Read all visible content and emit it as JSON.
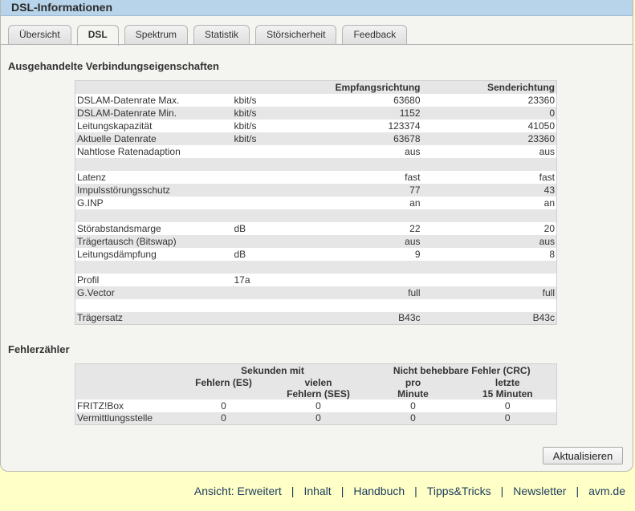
{
  "window": {
    "title": "DSL-Informationen"
  },
  "tabs": [
    "Übersicht",
    "DSL",
    "Spektrum",
    "Statistik",
    "Störsicherheit",
    "Feedback"
  ],
  "section1": {
    "title": "Ausgehandelte Verbindungseigenschaften",
    "headers": {
      "empfang": "Empfangsrichtung",
      "sende": "Senderichtung"
    },
    "rows": [
      {
        "label": "DSLAM-Datenrate Max.",
        "unit": "kbit/s",
        "rx": "63680",
        "tx": "23360"
      },
      {
        "label": "DSLAM-Datenrate Min.",
        "unit": "kbit/s",
        "rx": "1152",
        "tx": "0"
      },
      {
        "label": "Leitungskapazität",
        "unit": "kbit/s",
        "rx": "123374",
        "tx": "41050"
      },
      {
        "label": "Aktuelle Datenrate",
        "unit": "kbit/s",
        "rx": "63678",
        "tx": "23360"
      },
      {
        "label": "Nahtlose Ratenadaption",
        "unit": "",
        "rx": "aus",
        "tx": "aus"
      },
      {
        "label": "",
        "unit": "",
        "rx": "",
        "tx": ""
      },
      {
        "label": "Latenz",
        "unit": "",
        "rx": "fast",
        "tx": "fast"
      },
      {
        "label": "Impulsstörungsschutz",
        "unit": "",
        "rx": "77",
        "tx": "43"
      },
      {
        "label": "G.INP",
        "unit": "",
        "rx": "an",
        "tx": "an"
      },
      {
        "label": "",
        "unit": "",
        "rx": "",
        "tx": ""
      },
      {
        "label": "Störabstandsmarge",
        "unit": "dB",
        "rx": "22",
        "tx": "20"
      },
      {
        "label": "Trägertausch (Bitswap)",
        "unit": "",
        "rx": "aus",
        "tx": "aus"
      },
      {
        "label": "Leitungsdämpfung",
        "unit": "dB",
        "rx": "9",
        "tx": "8"
      },
      {
        "label": "",
        "unit": "",
        "rx": "",
        "tx": ""
      },
      {
        "label": "Profil",
        "unit": "17a",
        "rx": "",
        "tx": ""
      },
      {
        "label": "G.Vector",
        "unit": "",
        "rx": "full",
        "tx": "full"
      },
      {
        "label": "",
        "unit": "",
        "rx": "",
        "tx": ""
      },
      {
        "label": "Trägersatz",
        "unit": "",
        "rx": "B43c",
        "tx": "B43c"
      }
    ]
  },
  "section2": {
    "title": "Fehlerzähler",
    "group1": "Sekunden mit",
    "group2": "Nicht behebbare Fehler (CRC)",
    "col_es": "Fehlern (ES)",
    "col_ses_line1": "vielen",
    "col_ses_line2": "Fehlern (SES)",
    "col_pm_line1": "pro",
    "col_pm_line2": "Minute",
    "col_15_line1": "letzte",
    "col_15_line2": "15 Minuten",
    "rows": [
      {
        "label": "FRITZ!Box",
        "es": "0",
        "ses": "0",
        "pm": "0",
        "m15": "0"
      },
      {
        "label": "Vermittlungsstelle",
        "es": "0",
        "ses": "0",
        "pm": "0",
        "m15": "0"
      }
    ]
  },
  "buttons": {
    "refresh": "Aktualisieren"
  },
  "footer": [
    "Ansicht: Erweitert",
    "Inhalt",
    "Handbuch",
    "Tipps&Tricks",
    "Newsletter",
    "avm.de"
  ],
  "footer_sep": "|"
}
